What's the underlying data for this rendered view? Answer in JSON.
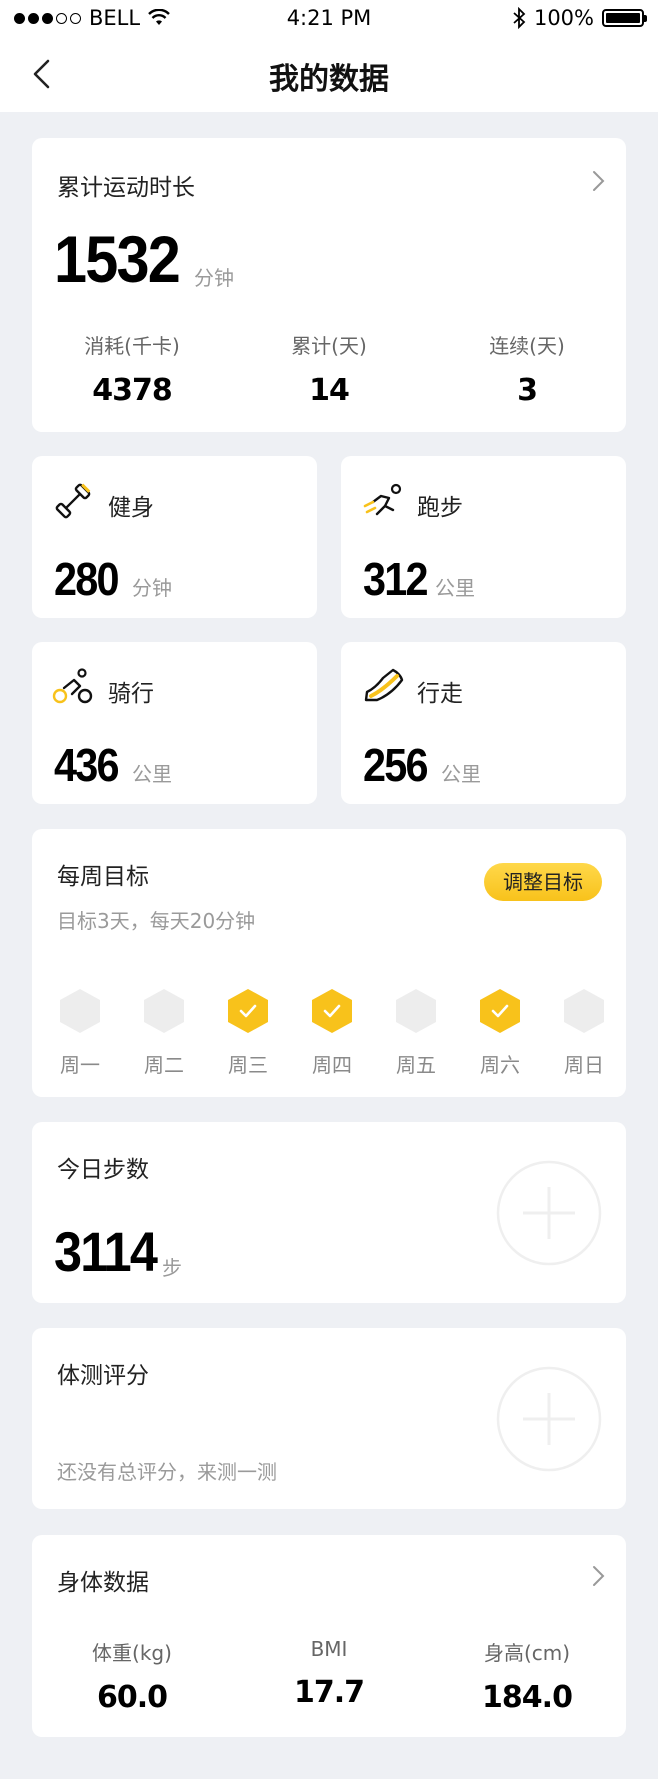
{
  "status": {
    "carrier": "BELL",
    "time": "4:21 PM",
    "battery": "100%"
  },
  "header": {
    "title": "我的数据"
  },
  "total": {
    "title": "累计运动时长",
    "value": "1532",
    "unit": "分钟",
    "stats": [
      {
        "label": "消耗(千卡)",
        "value": "4378"
      },
      {
        "label": "累计(天)",
        "value": "14"
      },
      {
        "label": "连续(天)",
        "value": "3"
      }
    ]
  },
  "sports": [
    {
      "name": "健身",
      "value": "280",
      "unit": "分钟",
      "icon": "dumbbell-icon"
    },
    {
      "name": "跑步",
      "value": "312",
      "unit": "公里",
      "icon": "running-icon"
    },
    {
      "name": "骑行",
      "value": "436",
      "unit": "公里",
      "icon": "cycling-icon"
    },
    {
      "name": "行走",
      "value": "256",
      "unit": "公里",
      "icon": "shoe-icon"
    }
  ],
  "weekly": {
    "title": "每周目标",
    "subtitle": "目标3天，每天20分钟",
    "adjust_label": "调整目标",
    "days": [
      {
        "label": "周一",
        "done": false
      },
      {
        "label": "周二",
        "done": false
      },
      {
        "label": "周三",
        "done": true
      },
      {
        "label": "周四",
        "done": true
      },
      {
        "label": "周五",
        "done": false
      },
      {
        "label": "周六",
        "done": true
      },
      {
        "label": "周日",
        "done": false
      }
    ]
  },
  "steps": {
    "title": "今日步数",
    "value": "3114",
    "unit": "步"
  },
  "fitness_test": {
    "title": "体测评分",
    "hint": "还没有总评分，来测一测"
  },
  "body": {
    "title": "身体数据",
    "stats": [
      {
        "label": "体重(kg)",
        "value": "60.0"
      },
      {
        "label": "BMI",
        "value": "17.7"
      },
      {
        "label": "身高(cm)",
        "value": "184.0"
      }
    ]
  },
  "colors": {
    "accent": "#f8c21b",
    "background": "#eef0f4",
    "hex_gray": "#ededed"
  }
}
